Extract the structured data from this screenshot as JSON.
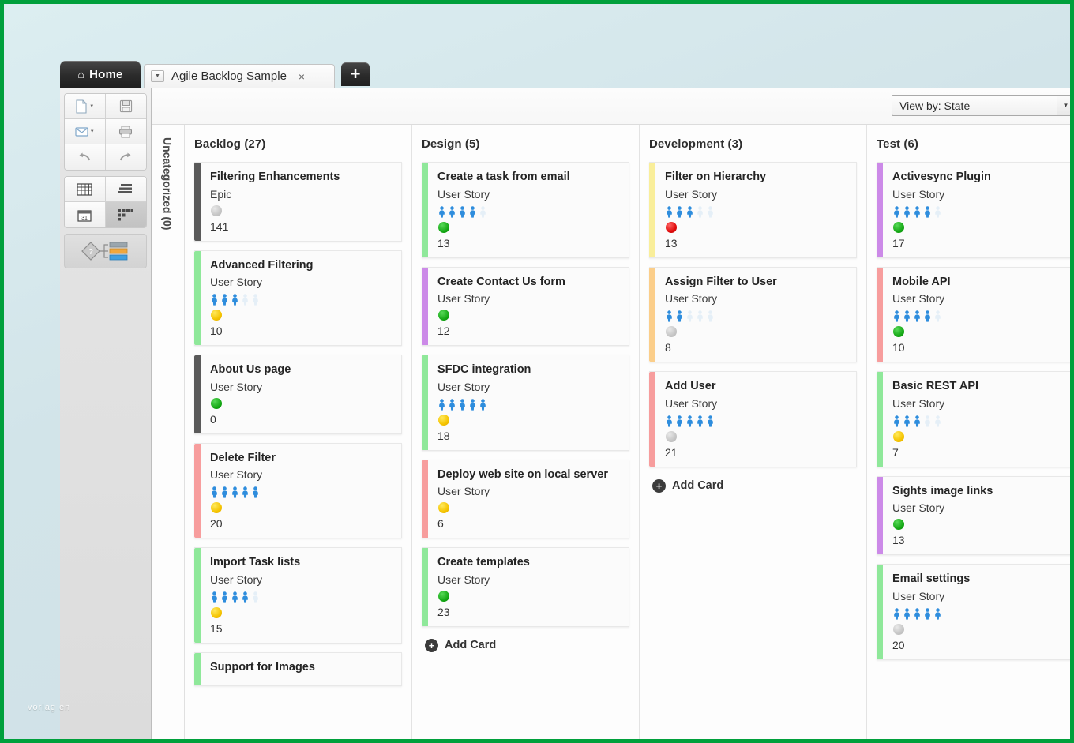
{
  "window": {
    "home_tab": "Home",
    "home_icon": "home-icon",
    "document_tab": "Agile Backlog Sample",
    "close_glyph": "×",
    "add_tab_glyph": "+",
    "caret_glyph": "▼"
  },
  "watermark": "vorlag en",
  "toolbar": {
    "buttons": [
      {
        "name": "new-document-button",
        "icon": "document-icon"
      },
      {
        "name": "save-button",
        "icon": "floppy-disk-icon"
      },
      {
        "name": "open-mail-button",
        "icon": "envelope-icon"
      },
      {
        "name": "print-button",
        "icon": "printer-icon"
      },
      {
        "name": "undo-button",
        "icon": "undo-arrow-icon"
      },
      {
        "name": "redo-button",
        "icon": "redo-arrow-icon"
      },
      {
        "name": "grid-view-button",
        "icon": "table-grid-icon"
      },
      {
        "name": "list-view-button",
        "icon": "list-icon"
      },
      {
        "name": "calendar-view-button",
        "icon": "calendar-icon"
      },
      {
        "name": "board-view-button",
        "icon": "kanban-board-icon"
      },
      {
        "name": "workflow-button",
        "icon": "workflow-diagram-icon"
      }
    ]
  },
  "viewbar": {
    "view_by_label": "View by: State",
    "arrow_glyph": "▼"
  },
  "swimlane": {
    "label": "Uncategorized (0)"
  },
  "board": {
    "add_card_label": "Add Card",
    "colors": {
      "green": "#8fe89a",
      "dark": "#5a5a5a",
      "red": "#f79d9d",
      "purple": "#cc8ae8",
      "yellow": "#f9ee9a",
      "orange": "#fbce8a",
      "person_blue": "#2e8ddd"
    },
    "columns": [
      {
        "title": "Backlog (27)",
        "name": "column-backlog",
        "show_add_card": false,
        "cards": [
          {
            "title": "Filtering Enhancements",
            "type": "Epic",
            "stripe": "dark",
            "people_filled": 0,
            "people_total": 0,
            "dot": "gray",
            "num": "141"
          },
          {
            "title": "Advanced Filtering",
            "type": "User Story",
            "stripe": "green",
            "people_filled": 3,
            "people_total": 5,
            "dot": "yellow",
            "num": "10"
          },
          {
            "title": "About Us page",
            "type": "User Story",
            "stripe": "dark",
            "people_filled": 0,
            "people_total": 0,
            "dot": "green",
            "num": "0"
          },
          {
            "title": "Delete Filter",
            "type": "User Story",
            "stripe": "red",
            "people_filled": 5,
            "people_total": 5,
            "dot": "yellow",
            "num": "20"
          },
          {
            "title": "Import Task lists",
            "type": "User Story",
            "stripe": "green",
            "people_filled": 4,
            "people_total": 5,
            "dot": "yellow",
            "num": "15"
          },
          {
            "title": "Support for Images",
            "type": "",
            "stripe": "green",
            "people_filled": 0,
            "people_total": 0,
            "dot": "",
            "num": ""
          }
        ]
      },
      {
        "title": "Design (5)",
        "name": "column-design",
        "show_add_card": true,
        "cards": [
          {
            "title": "Create a task from email",
            "type": "User Story",
            "stripe": "green",
            "people_filled": 4,
            "people_total": 5,
            "dot": "green",
            "num": "13"
          },
          {
            "title": "Create Contact Us form",
            "type": "User Story",
            "stripe": "purple",
            "people_filled": 0,
            "people_total": 0,
            "dot": "green",
            "num": "12"
          },
          {
            "title": "SFDC integration",
            "type": "User Story",
            "stripe": "green",
            "people_filled": 5,
            "people_total": 5,
            "dot": "yellow",
            "num": "18"
          },
          {
            "title": "Deploy web site on local server",
            "type": "User Story",
            "stripe": "red",
            "people_filled": 0,
            "people_total": 0,
            "dot": "yellow",
            "num": "6"
          },
          {
            "title": "Create templates",
            "type": "User Story",
            "stripe": "green",
            "people_filled": 0,
            "people_total": 0,
            "dot": "green",
            "num": "23"
          }
        ]
      },
      {
        "title": "Development (3)",
        "name": "column-development",
        "show_add_card": true,
        "cards": [
          {
            "title": "Filter on Hierarchy",
            "type": "User Story",
            "stripe": "yellow",
            "people_filled": 3,
            "people_total": 5,
            "dot": "red",
            "num": "13"
          },
          {
            "title": "Assign Filter to User",
            "type": "User Story",
            "stripe": "orange",
            "people_filled": 2,
            "people_total": 5,
            "dot": "gray",
            "num": "8"
          },
          {
            "title": "Add User",
            "type": "User Story",
            "stripe": "red",
            "people_filled": 5,
            "people_total": 5,
            "dot": "gray",
            "num": "21"
          }
        ]
      },
      {
        "title": "Test (6)",
        "name": "column-test",
        "show_add_card": false,
        "cards": [
          {
            "title": "Activesync Plugin",
            "type": "User Story",
            "stripe": "purple",
            "people_filled": 4,
            "people_total": 5,
            "dot": "green",
            "num": "17"
          },
          {
            "title": "Mobile API",
            "type": "User Story",
            "stripe": "red",
            "people_filled": 4,
            "people_total": 5,
            "dot": "green",
            "num": "10"
          },
          {
            "title": "Basic REST API",
            "type": "User Story",
            "stripe": "green",
            "people_filled": 3,
            "people_total": 5,
            "dot": "yellow",
            "num": "7"
          },
          {
            "title": "Sights image links",
            "type": "User Story",
            "stripe": "purple",
            "people_filled": 0,
            "people_total": 0,
            "dot": "green",
            "num": "13"
          },
          {
            "title": "Email settings",
            "type": "User Story",
            "stripe": "green",
            "people_filled": 5,
            "people_total": 5,
            "dot": "gray",
            "num": "20"
          }
        ]
      }
    ]
  }
}
